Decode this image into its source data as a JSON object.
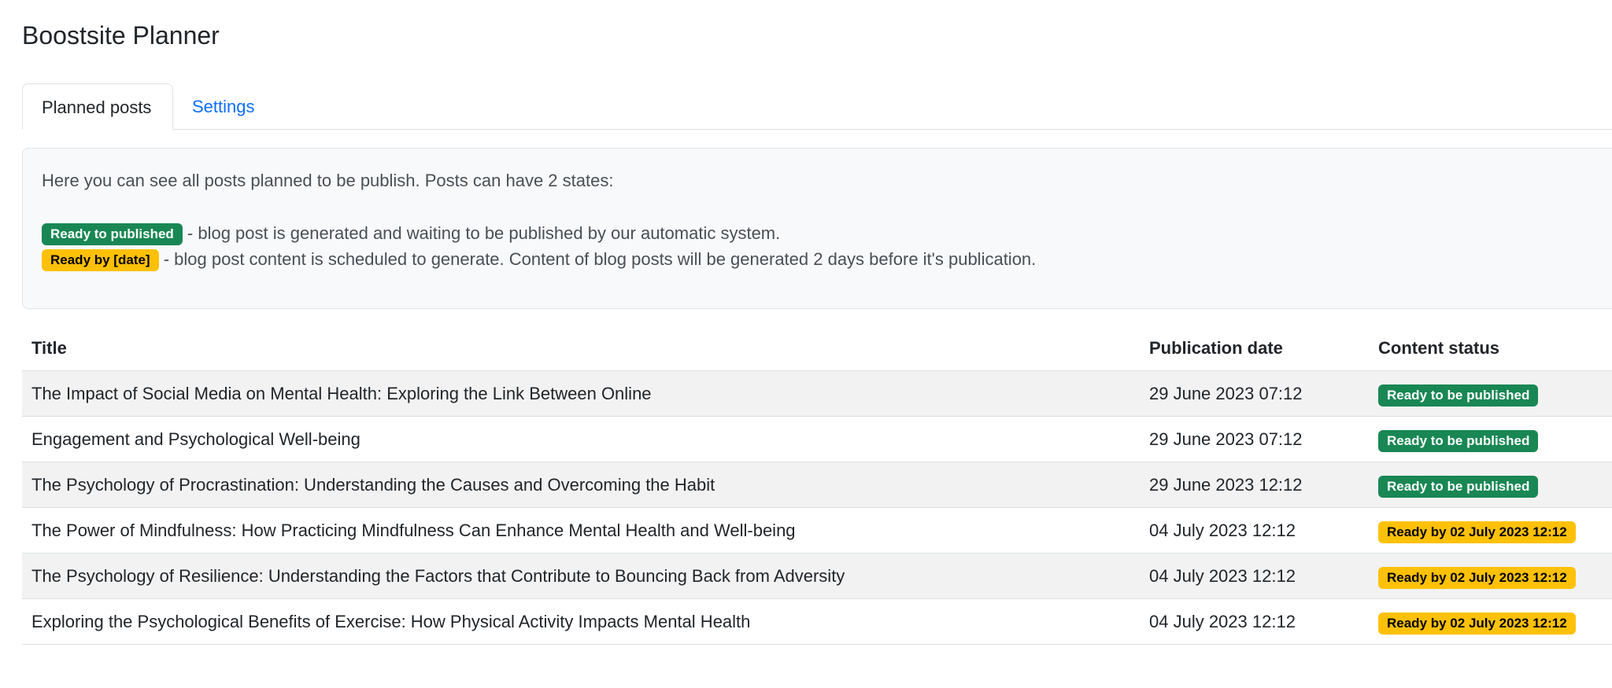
{
  "app": {
    "title": "Boostsite Planner"
  },
  "tabs": [
    {
      "label": "Planned posts",
      "active": true
    },
    {
      "label": "Settings",
      "active": false
    }
  ],
  "info": {
    "intro": "Here you can see all posts planned to be publish. Posts can have 2 states:",
    "states": [
      {
        "badge": "Ready to published",
        "color": "#198754",
        "description": " - blog post is generated and waiting to be published by our automatic system."
      },
      {
        "badge": "Ready by [date]",
        "color": "#ffc107",
        "description": " - blog post content is scheduled to generate. Content of blog posts will be generated 2 days before it's publication."
      }
    ]
  },
  "table": {
    "columns": [
      "Title",
      "Publication date",
      "Content status"
    ],
    "rows": [
      {
        "title": "The Impact of Social Media on Mental Health: Exploring the Link Between Online",
        "date": "29 June 2023 07:12",
        "status": "Ready to be published",
        "status_color": "#198754"
      },
      {
        "title": "Engagement and Psychological Well-being",
        "date": "29 June 2023 07:12",
        "status": "Ready to be published",
        "status_color": "#198754"
      },
      {
        "title": "The Psychology of Procrastination: Understanding the Causes and Overcoming the Habit",
        "date": "29 June 2023 12:12",
        "status": "Ready to be published",
        "status_color": "#198754"
      },
      {
        "title": "The Power of Mindfulness: How Practicing Mindfulness Can Enhance Mental Health and Well-being",
        "date": "04 July 2023 12:12",
        "status": "Ready by 02 July 2023 12:12",
        "status_color": "#ffc107"
      },
      {
        "title": "The Psychology of Resilience: Understanding the Factors that Contribute to Bouncing Back from Adversity",
        "date": "04 July 2023 12:12",
        "status": "Ready by 02 July 2023 12:12",
        "status_color": "#ffc107"
      },
      {
        "title": "Exploring the Psychological Benefits of Exercise: How Physical Activity Impacts Mental Health",
        "date": "04 July 2023 12:12",
        "status": "Ready by 02 July 2023 12:12",
        "status_color": "#ffc107"
      }
    ]
  }
}
